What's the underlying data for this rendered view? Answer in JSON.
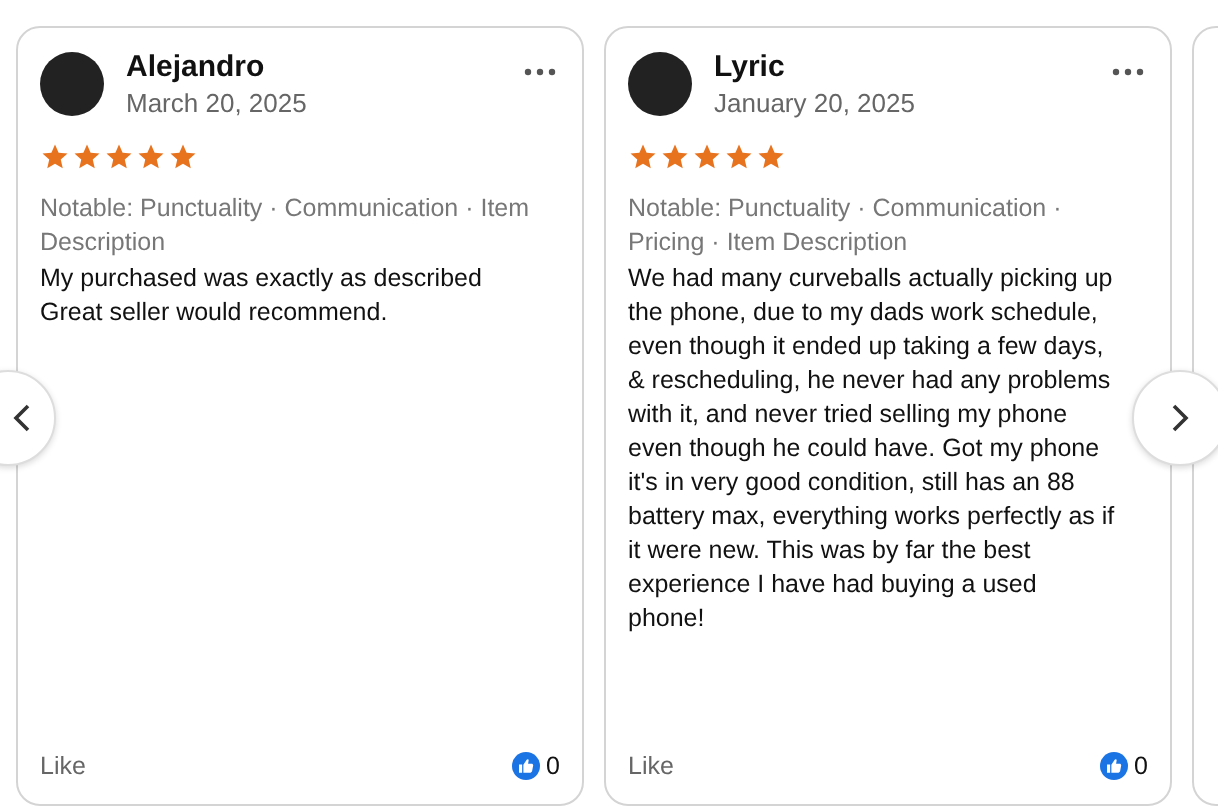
{
  "reviews": [
    {
      "name": "Alejandro",
      "date": "March 20, 2025",
      "stars": 5,
      "notable": "Notable: Punctuality · Communication · Item Description",
      "text": "My purchased was exactly as described Great seller would recommend.",
      "like": "Like",
      "like_count": "0"
    },
    {
      "name": "Lyric",
      "date": "January 20, 2025",
      "stars": 5,
      "notable": "Notable: Punctuality · Communication · Pricing · Item Description",
      "text": "We had many curveballs actually picking up the phone, due to my dads work schedule, even though it ended up taking a few days, & rescheduling, he never had any problems with it, and never tried selling my phone even though he could have. Got my phone it's in very good condition, still has an 88 battery max, everything works perfectly as if it were new. This was by far the best experience I have had buying a used phone!",
      "like": "Like",
      "like_count": "0"
    }
  ]
}
